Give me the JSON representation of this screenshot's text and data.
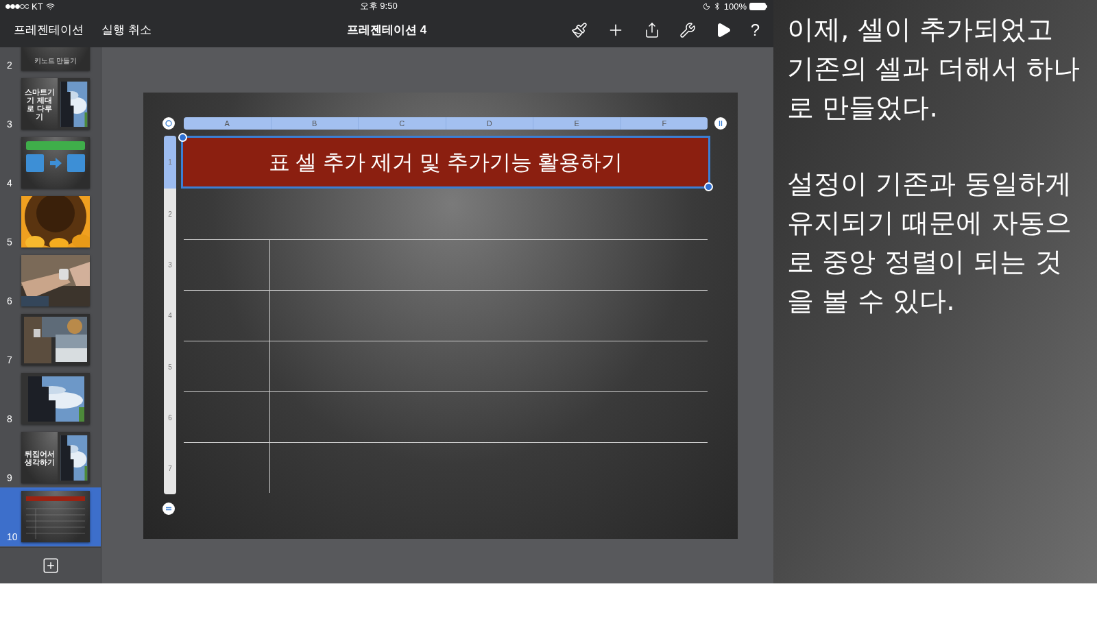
{
  "status_bar": {
    "carrier": "KT",
    "time": "오후 9:50",
    "battery": "100%"
  },
  "toolbar": {
    "buttons": [
      "프레젠테이션",
      "실행 취소"
    ],
    "title": "프레젠테이션 4",
    "help": "?"
  },
  "slides": [
    {
      "number": "2",
      "kind": "title-picture",
      "caption": "키노트 만들기",
      "selected": false
    },
    {
      "number": "3",
      "kind": "text-picture",
      "caption": "스마트기기 제대로 다루기",
      "selected": false
    },
    {
      "number": "4",
      "kind": "diagram",
      "selected": false
    },
    {
      "number": "5",
      "kind": "flower",
      "selected": false
    },
    {
      "number": "6",
      "kind": "wrist",
      "selected": false
    },
    {
      "number": "7",
      "kind": "collage",
      "selected": false
    },
    {
      "number": "8",
      "kind": "sky",
      "selected": false
    },
    {
      "number": "9",
      "kind": "text-picture",
      "caption": "뒤집어서 생각하기",
      "selected": false
    },
    {
      "number": "10",
      "kind": "table",
      "selected": true
    }
  ],
  "table": {
    "columns": [
      "A",
      "B",
      "C",
      "D",
      "E",
      "F"
    ],
    "rows": [
      {
        "label": "1",
        "selected": true,
        "title": "표 셀 추가 제거 및 추가기능 활용하기"
      },
      {
        "label": "2",
        "selected": false
      },
      {
        "label": "3",
        "selected": false
      },
      {
        "label": "4",
        "selected": false
      },
      {
        "label": "5",
        "selected": false
      },
      {
        "label": "6",
        "selected": false
      },
      {
        "label": "7",
        "selected": false
      }
    ]
  },
  "note": {
    "paragraphs": [
      "이제, 셀이 추가되었고 기존의 셀과 더해서 하나로 만들었다.",
      "설정이 기존과 동일하게 유지되기 때문에 자동으로 중앙 정렬이 되는 것을 볼 수 있다."
    ]
  }
}
